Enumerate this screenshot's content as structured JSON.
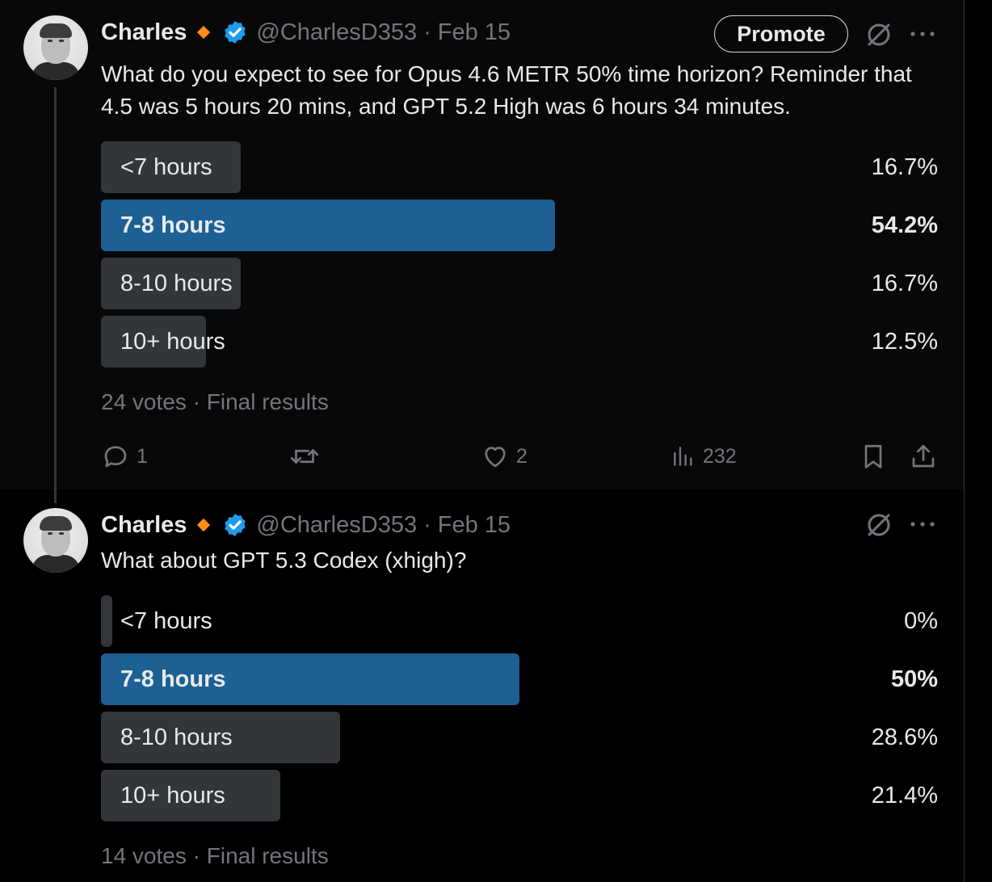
{
  "tweets": [
    {
      "author": {
        "name": "Charles",
        "handle": "@CharlesD353"
      },
      "date": "Feb 15",
      "promote_label": "Promote",
      "text": "What do you expect to see for Opus 4.6 METR 50% time horizon? Reminder that 4.5 was 5 hours 20 mins, and GPT 5.2 High was 6 hours 34 minutes.",
      "poll": {
        "options": [
          {
            "label": "<7 hours",
            "percent": "16.7%",
            "value": 16.7,
            "winner": false
          },
          {
            "label": "7-8 hours",
            "percent": "54.2%",
            "value": 54.2,
            "winner": true
          },
          {
            "label": "8-10 hours",
            "percent": "16.7%",
            "value": 16.7,
            "winner": false
          },
          {
            "label": "10+ hours",
            "percent": "12.5%",
            "value": 12.5,
            "winner": false
          }
        ],
        "votes": "24 votes",
        "status": "Final results"
      },
      "actions": {
        "replies": "1",
        "reposts": "",
        "likes": "2",
        "views": "232"
      }
    },
    {
      "author": {
        "name": "Charles",
        "handle": "@CharlesD353"
      },
      "date": "Feb 15",
      "text": "What about GPT 5.3 Codex (xhigh)?",
      "poll": {
        "options": [
          {
            "label": "<7 hours",
            "percent": "0%",
            "value": 0,
            "winner": false
          },
          {
            "label": "7-8 hours",
            "percent": "50%",
            "value": 50,
            "winner": true
          },
          {
            "label": "8-10 hours",
            "percent": "28.6%",
            "value": 28.6,
            "winner": false
          },
          {
            "label": "10+ hours",
            "percent": "21.4%",
            "value": 21.4,
            "winner": false
          }
        ],
        "votes": "14 votes",
        "status": "Final results"
      }
    }
  ],
  "separator": "·",
  "colors": {
    "background": "#000000",
    "text": "#e7e9ea",
    "muted": "#71767b",
    "poll_bar": "#333639",
    "poll_winner": "#1d6094",
    "verified": "#1d9bf0",
    "affiliate_badge": "#ff8c1a"
  },
  "icons": [
    "gold-diamond-icon",
    "verified-badge-icon",
    "grok-analyze-icon",
    "more-icon",
    "reply-icon",
    "repost-icon",
    "like-icon",
    "views-icon",
    "bookmark-icon",
    "share-icon"
  ]
}
